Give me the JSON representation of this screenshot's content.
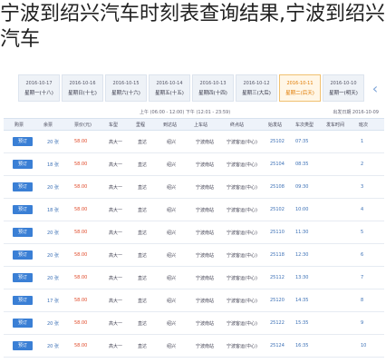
{
  "headline": "宁波到绍兴汽车时刻表查询结果,宁波到绍兴汽车",
  "date_tabs": [
    {
      "date": "2016-10-10",
      "week": "星期一(明天)",
      "active": false
    },
    {
      "date": "2016-10-11",
      "week": "星期二(后天)",
      "active": false
    },
    {
      "date": "2016-10-12",
      "week": "星期三(大后)",
      "active": false
    },
    {
      "date": "2016-10-13",
      "week": "星期四(十四)",
      "active": false
    },
    {
      "date": "2016-10-14",
      "week": "星期五(十五)",
      "active": false
    },
    {
      "date": "2016-10-15",
      "week": "星期六(十六)",
      "active": true
    },
    {
      "date": "2016-10-16",
      "week": "星期日(十七)",
      "active": false
    },
    {
      "date": "2016-10-17",
      "week": "星期一(十八)",
      "active": false
    }
  ],
  "nav": {
    "prev_icon": "‹",
    "next_icon": "‹"
  },
  "infobar": {
    "left": "出发日期 2016-10-09",
    "middle": "上午 (06:00 - 12:00)  下午 (12:01 - 23:59)",
    "right": "出发时间 ▾"
  },
  "columns": [
    "班次",
    "发车时间",
    "车次类型",
    "始发站",
    "终点站",
    "上车站",
    "到达站",
    "里程",
    "车型",
    "票价(元)",
    "余票",
    "购票"
  ],
  "rows": [
    {
      "no": "1",
      "time": "07:35",
      "code": "25102",
      "type": "流水",
      "from": "宁波客运(中心)",
      "to": "绍兴",
      "board": "宁波南站",
      "arrive": "绍兴",
      "dist": "直达",
      "model": "高大一",
      "price": "58.00",
      "left": "20 张",
      "btn": "预订"
    },
    {
      "no": "2",
      "time": "08:35",
      "code": "25104",
      "type": "流水",
      "from": "宁波客运(中心)",
      "to": "绍兴",
      "board": "宁波南站",
      "arrive": "绍兴",
      "dist": "直达",
      "model": "高大一",
      "price": "58.00",
      "left": "18 张",
      "btn": "预订"
    },
    {
      "no": "3",
      "time": "09:30",
      "code": "25108",
      "type": "流水",
      "from": "宁波客运(中心)",
      "to": "绍兴",
      "board": "宁波南站",
      "arrive": "绍兴",
      "dist": "直达",
      "model": "高大一",
      "price": "58.00",
      "left": "20 张",
      "btn": "预订"
    },
    {
      "no": "4",
      "time": "10:00",
      "code": "25102",
      "type": "流水",
      "from": "宁波客运(中心)",
      "to": "绍兴",
      "board": "宁波南站",
      "arrive": "绍兴",
      "dist": "直达",
      "model": "高大一",
      "price": "58.00",
      "left": "18 张",
      "btn": "预订"
    },
    {
      "no": "5",
      "time": "11:30",
      "code": "25110",
      "type": "流水",
      "from": "宁波客运(中心)",
      "to": "绍兴",
      "board": "宁波南站",
      "arrive": "绍兴",
      "dist": "直达",
      "model": "高大一",
      "price": "58.00",
      "left": "20 张",
      "btn": "预订"
    },
    {
      "no": "6",
      "time": "12:30",
      "code": "25118",
      "type": "流水",
      "from": "宁波客运(中心)",
      "to": "绍兴",
      "board": "宁波南站",
      "arrive": "绍兴",
      "dist": "直达",
      "model": "高大一",
      "price": "58.00",
      "left": "20 张",
      "btn": "预订"
    },
    {
      "no": "7",
      "time": "13:30",
      "code": "25112",
      "type": "流水",
      "from": "宁波客运(中心)",
      "to": "绍兴",
      "board": "宁波南站",
      "arrive": "绍兴",
      "dist": "直达",
      "model": "高大一",
      "price": "58.00",
      "left": "20 张",
      "btn": "预订"
    },
    {
      "no": "8",
      "time": "14:35",
      "code": "25120",
      "type": "流水",
      "from": "宁波客运(中心)",
      "to": "绍兴",
      "board": "宁波南站",
      "arrive": "绍兴",
      "dist": "直达",
      "model": "高大一",
      "price": "58.00",
      "left": "17 张",
      "btn": "预订"
    },
    {
      "no": "9",
      "time": "15:35",
      "code": "25122",
      "type": "流水",
      "from": "宁波客运(中心)",
      "to": "绍兴",
      "board": "宁波南站",
      "arrive": "绍兴",
      "dist": "直达",
      "model": "高大一",
      "price": "58.00",
      "left": "20 张",
      "btn": "预订"
    },
    {
      "no": "10",
      "time": "16:35",
      "code": "25124",
      "type": "流水",
      "from": "宁波客运(中心)",
      "to": "绍兴",
      "board": "宁波南站",
      "arrive": "绍兴",
      "dist": "直达",
      "model": "高大一",
      "price": "58.00",
      "left": "20 张",
      "btn": "预订"
    }
  ]
}
